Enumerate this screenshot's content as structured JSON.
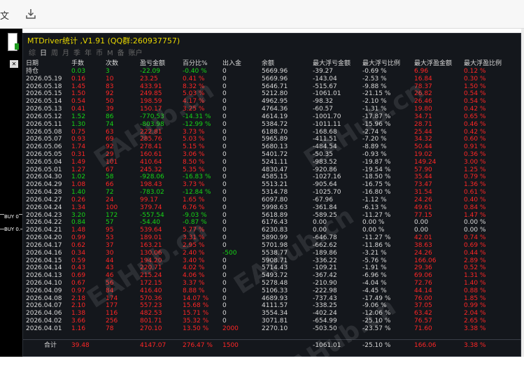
{
  "toolbar": {
    "left_text": "文",
    "icon": "download-icon"
  },
  "left_strip": {
    "labels": [
      "BUY 0",
      "BUY 0."
    ],
    "expand_icon": "x-icon"
  },
  "panel": {
    "title": "MTDriver统计 ,V1.91 (QQ群:260937757)",
    "tabs": [
      "综",
      "日",
      "周",
      "月",
      "季",
      "年",
      "币",
      "M",
      "备",
      "账户"
    ],
    "active_tab": "日",
    "headers": [
      "日期",
      "手数",
      "次数",
      "盈亏金额",
      "百分比%",
      "出入金",
      "余额",
      "最大浮亏金额",
      "最大浮亏比例",
      "最大浮盈金额",
      "最大浮盈比例"
    ],
    "rows": [
      [
        "持仓",
        "0.03",
        "3",
        "-22.09",
        "-0.40 %",
        "0",
        "5669.96",
        "-39.27",
        "-0.69 %",
        "6.96",
        "0.12 %"
      ],
      [
        "2026.05.19",
        "0.16",
        "10",
        "23.25",
        "0.41 %",
        "0",
        "5669.96",
        "-143.04",
        "-2.53 %",
        "16.84",
        "0.30 %"
      ],
      [
        "2026.05.18",
        "1.45",
        "83",
        "433.91",
        "8.32 %",
        "0",
        "5646.71",
        "-515.67",
        "-9.88 %",
        "78.37",
        "1.50 %"
      ],
      [
        "2026.05.15",
        "1.50",
        "92",
        "249.85",
        "5.03 %",
        "0",
        "5212.80",
        "-1061.01",
        "-21.15 %",
        "26.82",
        "0.54 %"
      ],
      [
        "2026.05.14",
        "0.54",
        "50",
        "198.59",
        "4.17 %",
        "0",
        "4962.95",
        "-98.32",
        "-2.10 %",
        "26.46",
        "0.54 %"
      ],
      [
        "2026.05.13",
        "0.41",
        "39",
        "150.17",
        "3.25 %",
        "0",
        "4764.36",
        "-60.57",
        "-1.31 %",
        "19.80",
        "0.42 %"
      ],
      [
        "2026.05.12",
        "1.52",
        "86",
        "-770.53",
        "-14.31 %",
        "0",
        "4614.19",
        "-1001.70",
        "-17.87 %",
        "34.71",
        "0.65 %"
      ],
      [
        "2026.05.11",
        "1.30",
        "74",
        "-803.98",
        "-12.99 %",
        "0",
        "5384.72",
        "-1011.11",
        "-15.96 %",
        "28.71",
        "0.46 %"
      ],
      [
        "2026.05.08",
        "0.75",
        "63",
        "222.81",
        "3.73 %",
        "0",
        "6188.70",
        "-168.68",
        "-2.74 %",
        "25.44",
        "0.42 %"
      ],
      [
        "2026.05.07",
        "0.93",
        "69",
        "285.76",
        "5.03 %",
        "0",
        "5965.89",
        "-411.51",
        "-7.20 %",
        "34.32",
        "0.60 %"
      ],
      [
        "2026.05.06",
        "1.74",
        "92",
        "278.41",
        "5.15 %",
        "0",
        "5680.13",
        "-484.54",
        "-8.89 %",
        "50.44",
        "0.91 %"
      ],
      [
        "2026.05.05",
        "0.31",
        "29",
        "160.61",
        "3.06 %",
        "0",
        "5401.72",
        "-50.35",
        "-0.93 %",
        "19.02",
        "0.36 %"
      ],
      [
        "2026.05.04",
        "1.49",
        "101",
        "410.64",
        "8.50 %",
        "0",
        "5241.11",
        "-983.52",
        "-19.87 %",
        "149.24",
        "3.00 %"
      ],
      [
        "2026.05.01",
        "1.27",
        "67",
        "245.32",
        "5.35 %",
        "0",
        "4830.47",
        "-920.86",
        "-19.54 %",
        "57.90",
        "1.25 %"
      ],
      [
        "2026.04.30",
        "1.02",
        "58",
        "-928.06",
        "-16.83 %",
        "0",
        "4585.15",
        "-1027.16",
        "-18.50 %",
        "35.44",
        "0.79 %"
      ],
      [
        "2026.04.29",
        "1.08",
        "66",
        "198.43",
        "3.73 %",
        "0",
        "5513.21",
        "-905.64",
        "-16.75 %",
        "73.47",
        "1.36 %"
      ],
      [
        "2026.04.28",
        "1.40",
        "72",
        "-783.02",
        "-12.84 %",
        "0",
        "5314.78",
        "-1025.70",
        "-16.80 %",
        "31.54",
        "0.61 %"
      ],
      [
        "2026.04.27",
        "0.26",
        "24",
        "99.17",
        "1.65 %",
        "0",
        "6097.80",
        "-67.96",
        "-1.12 %",
        "24.26",
        "0.40 %"
      ],
      [
        "2026.04.24",
        "1.34",
        "100",
        "379.74",
        "6.76 %",
        "0",
        "5998.63",
        "-361.84",
        "-6.13 %",
        "49.61",
        "0.84 %"
      ],
      [
        "2026.04.23",
        "3.20",
        "172",
        "-557.54",
        "-9.03 %",
        "0",
        "5618.89",
        "-589.25",
        "-11.27 %",
        "77.15",
        "1.47 %"
      ],
      [
        "2026.04.22",
        "0.84",
        "57",
        "-54.40",
        "-0.87 %",
        "0",
        "6176.43",
        "0.00",
        "0.00 %",
        "0.00",
        "0.00 %"
      ],
      [
        "2026.04.21",
        "1.48",
        "95",
        "539.64",
        "5.77 %",
        "0",
        "6230.83",
        "0.00",
        "0.00 %",
        "0.00",
        "0.00 %"
      ],
      [
        "2026.04.20",
        "0.99",
        "53",
        "189.01",
        "3.31 %",
        "0",
        "5890.99",
        "-646.78",
        "-11.27 %",
        "42.01",
        "0.74 %"
      ],
      [
        "2026.04.17",
        "0.62",
        "37",
        "163.21",
        "2.95 %",
        "0",
        "5701.98",
        "-662.62",
        "-11.86 %",
        "38.63",
        "0.69 %"
      ],
      [
        "2026.04.16",
        "0.34",
        "30",
        "130.06",
        "2.40 %",
        "-500",
        "5538.77",
        "-189.86",
        "-3.21 %",
        "24.26",
        "0.44 %"
      ],
      [
        "2026.04.15",
        "0.59",
        "44",
        "194.20",
        "3.40 %",
        "0",
        "5908.71",
        "-336.22",
        "-5.76 %",
        "166.06",
        "2.89 %"
      ],
      [
        "2026.04.14",
        "0.43",
        "43",
        "220.71",
        "4.02 %",
        "0",
        "5714.43",
        "-109.21",
        "-1.91 %",
        "29.36",
        "0.52 %"
      ],
      [
        "2026.04.13",
        "0.69",
        "46",
        "215.24",
        "4.06 %",
        "0",
        "5493.72",
        "-367.42",
        "-6.96 %",
        "69.06",
        "1.31 %"
      ],
      [
        "2026.04.10",
        "0.67",
        "56",
        "172.15",
        "3.37 %",
        "0",
        "5278.48",
        "-210.90",
        "-4.04 %",
        "72.76",
        "1.40 %"
      ],
      [
        "2026.04.09",
        "0.97",
        "84",
        "416.40",
        "8.88 %",
        "0",
        "5106.33",
        "-222.98",
        "-4.45 %",
        "44.14",
        "0.88 %"
      ],
      [
        "2026.04.08",
        "2.18",
        "174",
        "570.36",
        "14.07 %",
        "0",
        "4689.93",
        "-737.43",
        "-17.49 %",
        "76.00",
        "1.85 %"
      ],
      [
        "2026.04.07",
        "2.10",
        "177",
        "557.23",
        "15.68 %",
        "0",
        "4111.57",
        "-338.25",
        "-9.06 %",
        "37.05",
        "0.99 %"
      ],
      [
        "2026.04.06",
        "1.38",
        "116",
        "482.53",
        "15.71 %",
        "0",
        "3554.34",
        "-402.24",
        "-12.06 %",
        "63.42",
        "2.04 %"
      ],
      [
        "2026.04.02",
        "3.66",
        "256",
        "801.71",
        "35.32 %",
        "0",
        "3071.81",
        "-654.99",
        "-25.10 %",
        "76.57",
        "2.65 %"
      ],
      [
        "2026.04.01",
        "1.16",
        "78",
        "270.10",
        "13.50 %",
        "2000",
        "2270.10",
        "-503.50",
        "-23.57 %",
        "71.60",
        "3.38 %"
      ]
    ],
    "total": [
      "合计",
      "39.48",
      "",
      "4147.07",
      "276.47 %",
      "1500",
      "",
      "-1061.01",
      "-25.10 %",
      "166.06",
      "3.38 %"
    ]
  },
  "watermark": "EAHub.cn",
  "colors": {
    "profit": "#ff2626",
    "loss": "#16d416",
    "neutral": "#d8d8d8",
    "title": "#e8d800",
    "panel_bg": "#14171c"
  }
}
